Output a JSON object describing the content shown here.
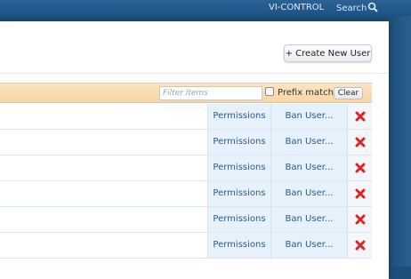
{
  "topbar": {
    "vi_control": "VI-CONTROL",
    "search": "Search"
  },
  "toolbar": {
    "create_new_user": "+ Create New User"
  },
  "filter": {
    "placeholder": "Filter items",
    "prefix_match": "Prefix match",
    "clear": "Clear"
  },
  "rows": [
    {
      "permissions": "Permissions",
      "ban": "Ban User..."
    },
    {
      "permissions": "Permissions",
      "ban": "Ban User..."
    },
    {
      "permissions": "Permissions",
      "ban": "Ban User..."
    },
    {
      "permissions": "Permissions",
      "ban": "Ban User..."
    },
    {
      "permissions": "Permissions",
      "ban": "Ban User..."
    },
    {
      "permissions": "Permissions",
      "ban": "Ban User..."
    }
  ],
  "icons": {
    "search": "magnifier-icon",
    "delete": "red-x-icon"
  },
  "colors": {
    "topbar": "#2b6196",
    "filterbar": "#f9dcb2",
    "cell": "#e6f1fb",
    "delete": "#e02424"
  }
}
